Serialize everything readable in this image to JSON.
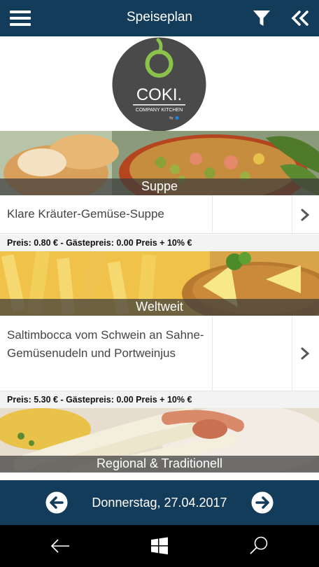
{
  "header": {
    "title": "Speiseplan",
    "menu_icon": "hamburger-menu-icon",
    "filter_icon": "filter-icon",
    "collapse_icon": "double-chevron-left-icon",
    "background_color": "#123c5a"
  },
  "logo": {
    "brand": "COKI.",
    "subtitle": "COMPANY KITCHEN",
    "by": "by"
  },
  "sections": [
    {
      "category": "Suppe",
      "dish": "Klare Kräuter-Gemüse-Suppe",
      "price": "Preis: 0.80 € - Gästepreis: 0.00 Preis + 10% €"
    },
    {
      "category": "Weltweit",
      "dish": "Saltimbocca vom Schwein an Sahne- Gemüsenudeln und Portweinjus",
      "price": "Preis: 5.30 € - Gästepreis: 0.00 Preis + 10% €"
    },
    {
      "category": "Regional & Traditionell"
    }
  ],
  "datebar": {
    "date": "Donnerstag, 27.04.2017",
    "prev_icon": "arrow-left-circle-icon",
    "next_icon": "arrow-right-circle-icon"
  },
  "system_bar": {
    "back_icon": "back-arrow-icon",
    "windows_icon": "windows-logo-icon",
    "search_icon": "search-icon"
  }
}
